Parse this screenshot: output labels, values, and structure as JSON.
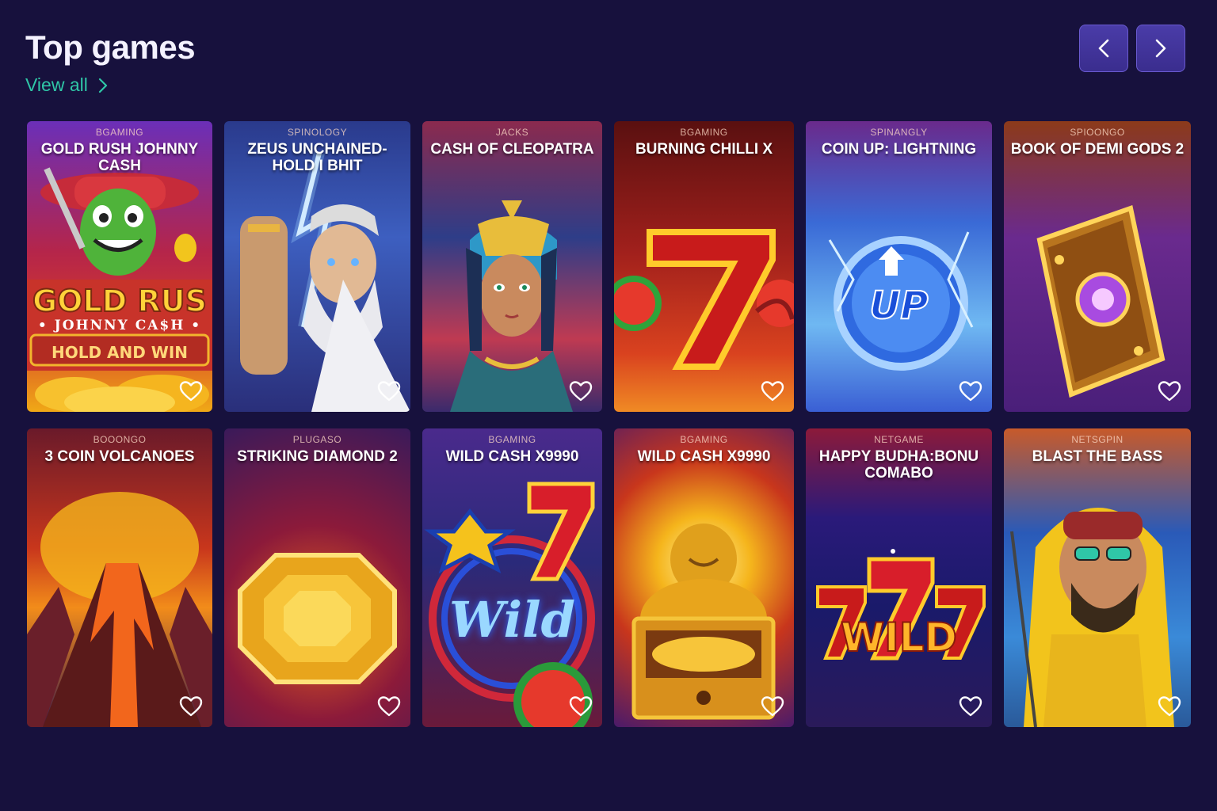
{
  "section": {
    "title": "Top games",
    "view_all": "View all"
  },
  "colors": {
    "background": "#17113d",
    "accent": "#2fc7a7",
    "nav_button": "#4a3ca8"
  },
  "games": [
    {
      "provider": "BGAMING",
      "name": "GOLD RUSH JOHNNY CASH",
      "art_text_1": "GOLD RUS",
      "art_text_2": "• JOHNNY CA$H •",
      "art_text_3": "HOLD AND WIN",
      "icon": "cactus-icon"
    },
    {
      "provider": "SPINOLOGY",
      "name": "ZEUS UNCHAINED-HOLD I BHIT",
      "icon": "zeus-icon"
    },
    {
      "provider": "JACKS",
      "name": "CASH OF CLEOPATRA",
      "icon": "cleopatra-icon"
    },
    {
      "provider": "BGAMING",
      "name": "BURNING CHILLI X",
      "icon": "seven-icon"
    },
    {
      "provider": "SPINANGLY",
      "name": "COIN UP: LIGHTNING",
      "art_text_1": "UP",
      "icon": "coin-icon"
    },
    {
      "provider": "SPIOONGO",
      "name": "BOOK OF DEMI GODS 2",
      "icon": "book-icon"
    },
    {
      "provider": "BOOONGO",
      "name": "3 COIN VOLCANOES",
      "icon": "volcano-icon"
    },
    {
      "provider": "PLUGASO",
      "name": "STRIKING DIAMOND 2",
      "icon": "gem-icon"
    },
    {
      "provider": "BGAMING",
      "name": "WILD CASH X9990",
      "art_text_1": "Wild",
      "icon": "wild-seven-icon"
    },
    {
      "provider": "BGAMING",
      "name": "WILD CASH X9990",
      "icon": "buddha-icon"
    },
    {
      "provider": "NETGAME",
      "name": "HAPPY BUDHA:BONU COMABO",
      "art_text_1": "WILD",
      "icon": "triple-seven-icon"
    },
    {
      "provider": "NETSGPIN",
      "name": "BLAST THE BASS",
      "icon": "fisherman-icon"
    }
  ]
}
